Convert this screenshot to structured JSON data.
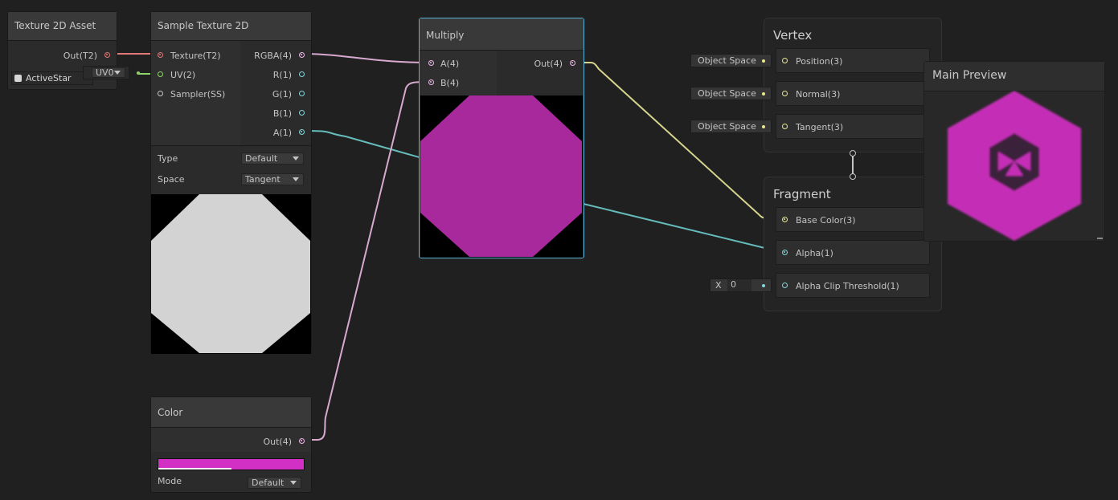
{
  "nodes": {
    "texture_asset": {
      "title": "Texture 2D Asset",
      "out_label": "Out(T2)",
      "asset_name": "ActiveStar"
    },
    "uv_chip": {
      "label": "UV0"
    },
    "sample_texture": {
      "title": "Sample Texture 2D",
      "inputs": [
        "Texture(T2)",
        "UV(2)",
        "Sampler(SS)"
      ],
      "outputs": [
        "RGBA(4)",
        "R(1)",
        "G(1)",
        "B(1)",
        "A(1)"
      ],
      "type_label": "Type",
      "type_value": "Default",
      "space_label": "Space",
      "space_value": "Tangent"
    },
    "color": {
      "title": "Color",
      "out_label": "Out(4)",
      "mode_label": "Mode",
      "mode_value": "Default",
      "swatch_color": "#d22fc4"
    },
    "multiply": {
      "title": "Multiply",
      "input_a": "A(4)",
      "input_b": "B(4)",
      "out_label": "Out(4)"
    },
    "vertex": {
      "title": "Vertex",
      "slots": [
        {
          "space": "Object Space",
          "label": "Position(3)"
        },
        {
          "space": "Object Space",
          "label": "Normal(3)"
        },
        {
          "space": "Object Space",
          "label": "Tangent(3)"
        }
      ]
    },
    "fragment": {
      "title": "Fragment",
      "base_color": "Base Color(3)",
      "alpha": "Alpha(1)",
      "alpha_clip": "Alpha Clip Threshold(1)",
      "alpha_clip_axis": "X",
      "alpha_clip_value": "0"
    },
    "main_preview": {
      "title": "Main Preview"
    }
  },
  "colors": {
    "texture_port": "#e27979",
    "vector2_port": "#8fd36b",
    "vector4_port": "#f1b8e7",
    "vector1_port": "#83d8d8",
    "vector3_port": "#e8e78e",
    "magenta": "#a8299b",
    "preview_magenta": "#c42fb6"
  }
}
